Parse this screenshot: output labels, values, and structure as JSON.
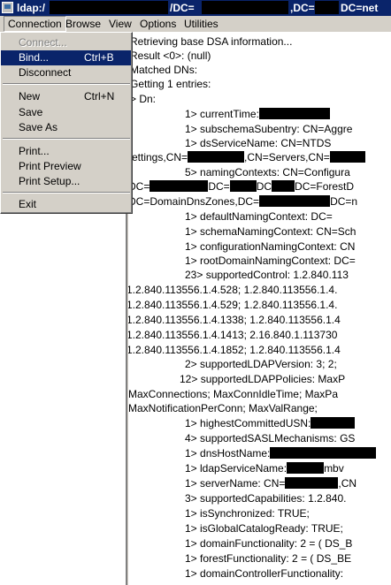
{
  "window": {
    "title_prefix": "ldap:/",
    "title_seg1": "/DC=",
    "title_seg2": ",DC=",
    "title_seg3": "DC=net"
  },
  "menubar": {
    "items": [
      "Connection",
      "Browse",
      "View",
      "Options",
      "Utilities"
    ]
  },
  "connection_menu": {
    "connect": "Connect...",
    "bind": "Bind...",
    "bind_shortcut": "Ctrl+B",
    "disconnect": "Disconnect",
    "new": "New",
    "new_shortcut": "Ctrl+N",
    "save": "Save",
    "save_as": "Save As",
    "print": "Print...",
    "print_preview": "Print Preview",
    "print_setup": "Print Setup...",
    "exit": "Exit"
  },
  "output": {
    "l01": "Retrieving base DSA information...",
    "l02": "Result <0>: (null)",
    "l03": "Matched DNs:",
    "l04": "Getting 1 entries:",
    "l05": "Dn:",
    "l06": "1> currentTime:",
    "l07": "1> subschemaSubentry: CN=Aggre",
    "l08": "1> dsServiceName: CN=NTDS",
    "l09a": "Settings,CN=",
    "l09b": ",CN=Servers,CN=",
    "l10": "5> namingContexts: CN=Configura",
    "l11a": "DC=",
    "l11b": "DC=",
    "l11c": "DC",
    "l11d": "DC=ForestD",
    "l12a": "DC=DomainDnsZones,DC=",
    "l12b": "DC=n",
    "l13": "1> defaultNamingContext: DC=",
    "l14": "1> schemaNamingContext: CN=Sch",
    "l15": "1> configurationNamingContext: CN",
    "l16": "1> rootDomainNamingContext: DC=",
    "l17": "23> supportedControl: 1.2.840.113",
    "l18": "1.2.840.113556.1.4.528; 1.2.840.113556.1.4.",
    "l19": "1.2.840.113556.1.4.529; 1.2.840.113556.1.4.",
    "l20": "1.2.840.113556.1.4.1338; 1.2.840.113556.1.4",
    "l21": "1.2.840.113556.1.4.1413; 2.16.840.1.113730",
    "l22": "1.2.840.113556.1.4.1852; 1.2.840.113556.1.4",
    "l23": "2> supportedLDAPVersion: 3; 2;",
    "l24": "12> supportedLDAPPolicies: MaxP",
    "l25": "MaxConnections; MaxConnIdleTime; MaxPa",
    "l26": "MaxNotificationPerConn; MaxValRange;",
    "l27": "1> highestCommittedUSN:",
    "l28": "4> supportedSASLMechanisms: GS",
    "l29": "1> dnsHostName:",
    "l30": "1> ldapServiceName:",
    "l30b": "mbv",
    "l31": "1> serverName: CN=",
    "l31b": ",CN",
    "l32": "3> supportedCapabilities: 1.2.840.",
    "l33": "1> isSynchronized: TRUE;",
    "l34": "1> isGlobalCatalogReady: TRUE;",
    "l35": "1> domainFunctionality: 2 = ( DS_B",
    "l36": "1> forestFunctionality: 2 = ( DS_BE",
    "l37": "1> domainControllerFunctionality:"
  }
}
